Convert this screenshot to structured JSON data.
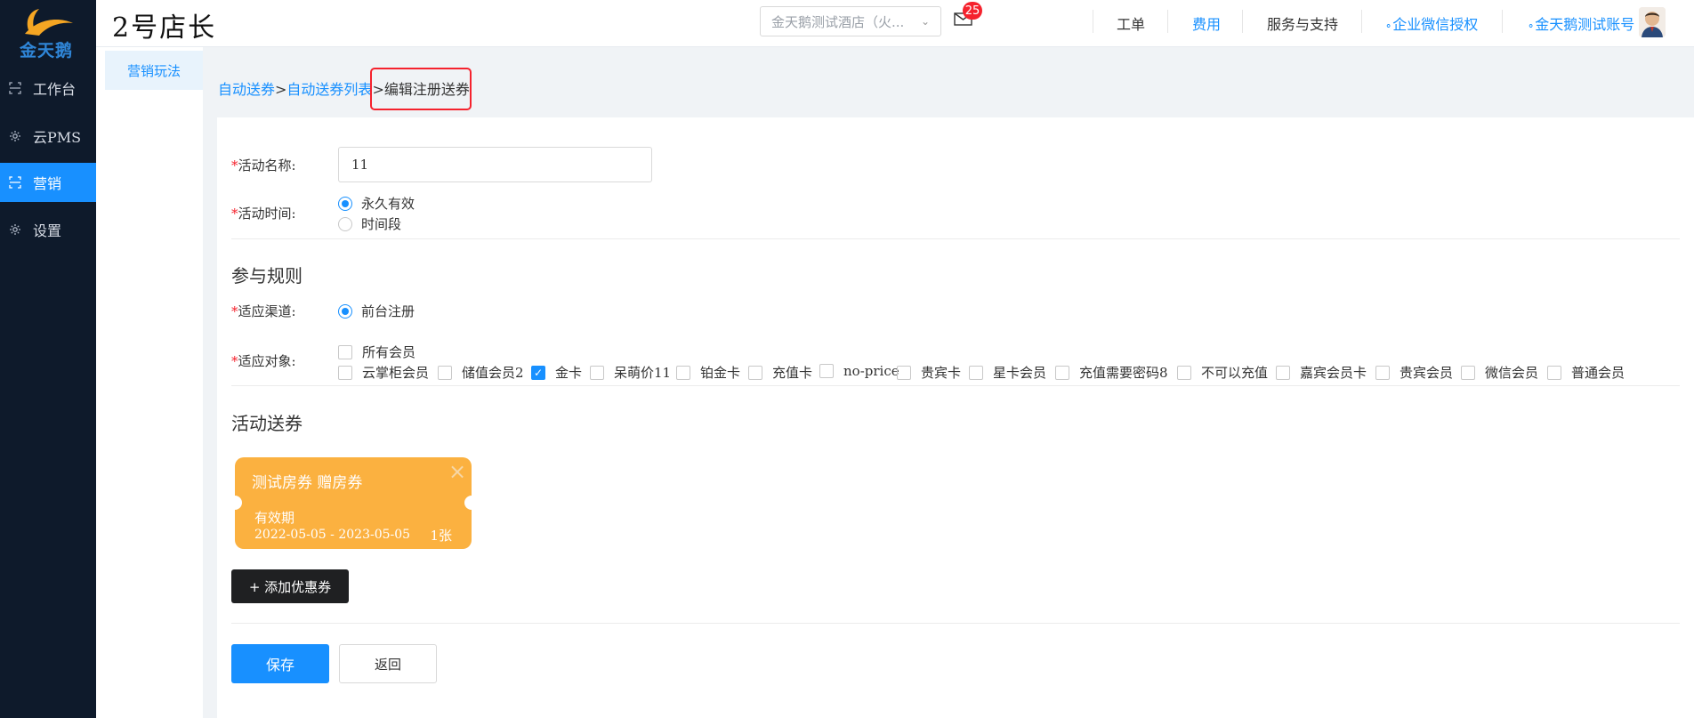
{
  "sidebar": {
    "logo_text": "金天鹅",
    "items": [
      {
        "label": "工作台",
        "icon": "scan-icon"
      },
      {
        "label": "云PMS",
        "icon": "gear-icon"
      },
      {
        "label": "营销",
        "icon": "scan-icon"
      },
      {
        "label": "设置",
        "icon": "gear-icon"
      }
    ]
  },
  "header": {
    "brand": "2号店长",
    "hotel_select": "金天鹅测试酒店（火...",
    "mail_badge": "25",
    "links": {
      "ticket": "工单",
      "fee": "费用",
      "support": "服务与支持",
      "wechat_auth": "企业微信授权",
      "account": "金天鹅测试账号"
    }
  },
  "submenu": {
    "item": "营销玩法"
  },
  "breadcrumb": {
    "first": "自动送券",
    "second": "自动送券列表",
    "sep": ">",
    "current": "编辑注册送券"
  },
  "form": {
    "required_mark": "*",
    "name_label": "活动名称:",
    "name_value": "11",
    "time_label": "活动时间:",
    "time_options": [
      "永久有效",
      "时间段"
    ],
    "rules_title": "参与规则",
    "channel_label": "适应渠道:",
    "channel_option": "前台注册",
    "target_label": "适应对象:",
    "all_members": "所有会员",
    "targets": [
      "云掌柜会员",
      "储值会员2",
      "金卡",
      "呆萌价11",
      "铂金卡",
      "充值卡",
      "no-price",
      "贵宾卡",
      "星卡会员",
      "充值需要密码8",
      "不可以充值",
      "嘉宾会员卡",
      "贵宾会员",
      "微信会员",
      "普通会员"
    ],
    "coupon_title": "活动送券",
    "coupon": {
      "name": "测试房券 赠房券",
      "validity_label": "有效期",
      "validity": "2022-05-05 - 2023-05-05",
      "count": "1张"
    },
    "add_coupon": "+ 添加优惠券",
    "save": "保存",
    "back": "返回"
  },
  "colors": {
    "primary": "#1890ff",
    "sidebar": "#0e1a2b",
    "coupon": "#fbb140",
    "required": "#f5222d"
  }
}
